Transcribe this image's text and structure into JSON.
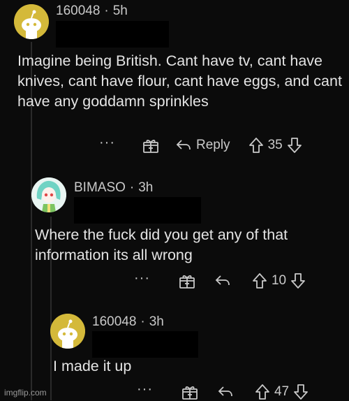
{
  "comments": [
    {
      "username": "160048",
      "time": "5h",
      "text": "Imagine being British. Cant have tv, cant have knives, cant have flour, cant have eggs, and cant have any goddamn sprinkles",
      "reply_label": "Reply",
      "score": "35",
      "ellipsis": "···"
    },
    {
      "username": "BIMASO",
      "time": "3h",
      "text": "Where the fuck did you get any of that information its all wrong",
      "score": "10",
      "ellipsis": "···"
    },
    {
      "username": "160048",
      "time": "3h",
      "text": "I made it up",
      "score": "47",
      "ellipsis": "···"
    }
  ],
  "separator": "·",
  "watermark": "imgflip.com",
  "colors": {
    "background": "#0b0b0b",
    "snoo_avatar_bg": "#d4b93a",
    "anime_avatar_bg": "#e9f5f2"
  }
}
